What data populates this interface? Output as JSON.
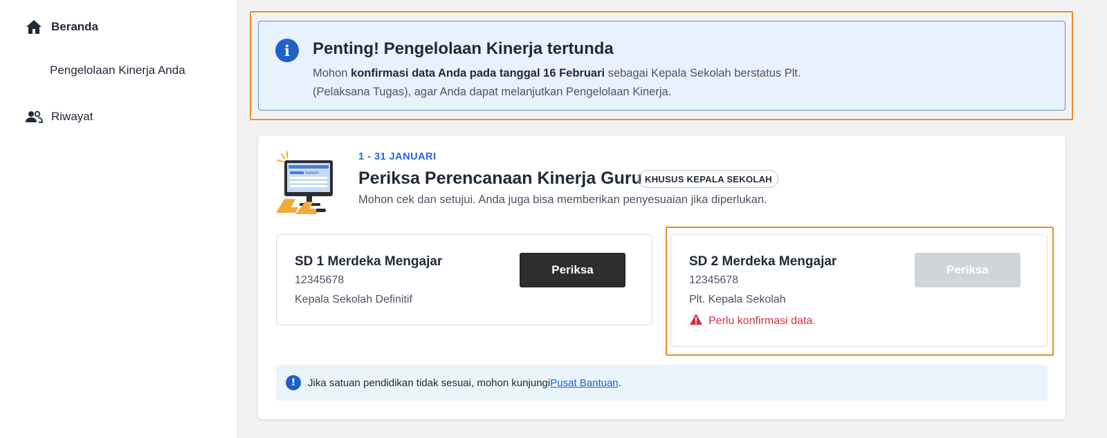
{
  "sidebar": {
    "items": [
      {
        "label": "Beranda",
        "icon": "home-icon",
        "active": true
      },
      {
        "label": "Pengelolaan Kinerja Anda",
        "icon": "",
        "active": false
      },
      {
        "label": "Riwayat",
        "icon": "people-icon",
        "active": false
      }
    ]
  },
  "alert": {
    "icon": "info-icon",
    "title": "Penting! Pengelolaan Kinerja tertunda",
    "body_prefix": "Mohon ",
    "body_bold": "konfirmasi data Anda pada tanggal 16 Februari",
    "body_suffix": " sebagai Kepala Sekolah berstatus Plt. (Pelaksana Tugas), agar Anda dapat melanjutkan Pengelolaan Kinerja."
  },
  "card": {
    "illustration": "computer-review-illustration",
    "period": "1 - 31 JANUARI",
    "title": "Periksa Perencanaan Kinerja Guru",
    "badge": "KHUSUS KEPALA SEKOLAH",
    "subtitle": "Mohon cek dan setujui. Anda juga bisa memberikan penyesuaian jika diperlukan.",
    "schools": [
      {
        "name": "SD 1 Merdeka Mengajar",
        "npsn": "12345678",
        "role": "Kepala Sekolah Definitif",
        "button": "Periksa",
        "enabled": true
      },
      {
        "name": "SD 2 Merdeka Mengajar",
        "npsn": "12345678",
        "role": "Plt. Kepala Sekolah",
        "button": "Periksa",
        "enabled": false,
        "warning": "Perlu konfirmasi data."
      }
    ],
    "info": {
      "text": "Jika satuan pendidikan tidak sesuai, mohon kunjungi ",
      "link": "Pusat Bantuan",
      "suffix": "."
    }
  },
  "colors": {
    "accent_blue": "#1d62c9",
    "highlight_orange": "#f08a24",
    "danger_red": "#d12f3f",
    "primary_button": "#2c2d2f",
    "disabled_button": "#d1d4d9"
  }
}
